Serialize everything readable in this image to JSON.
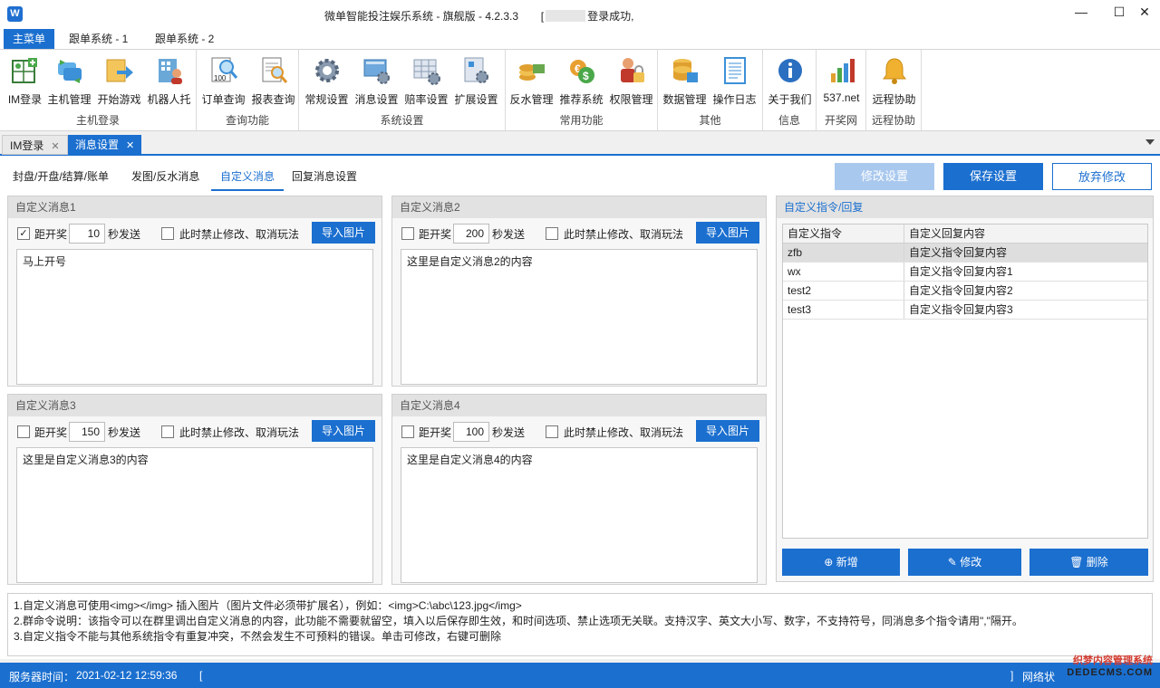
{
  "window": {
    "title_prefix": "微单智能投注娱乐系统 - 旗舰版 - 4.2.3.3",
    "title_bracket_open": "[",
    "title_suffix": "登录成功,",
    "minimize": "—",
    "maximize": "☐",
    "close": "✕",
    "app_icon": "W"
  },
  "ribbon_tabs": [
    "主菜单",
    "跟单系统 - 1",
    "跟单系统 - 2"
  ],
  "ribbon_groups": [
    {
      "label": "主机登录",
      "buttons": [
        "IM登录",
        "主机管理",
        "开始游戏",
        "机器人托"
      ]
    },
    {
      "label": "查询功能",
      "buttons": [
        "订单查询",
        "报表查询"
      ]
    },
    {
      "label": "系统设置",
      "buttons": [
        "常规设置",
        "消息设置",
        "赔率设置",
        "扩展设置"
      ]
    },
    {
      "label": "常用功能",
      "buttons": [
        "反水管理",
        "推荐系统",
        "权限管理"
      ]
    },
    {
      "label": "其他",
      "buttons": [
        "数据管理",
        "操作日志"
      ]
    },
    {
      "label": "信息",
      "buttons": [
        "关于我们"
      ]
    },
    {
      "label": "开奖网",
      "buttons": [
        "537.net"
      ]
    },
    {
      "label": "远程协助",
      "buttons": [
        "远程协助"
      ]
    }
  ],
  "icon_texts": {
    "order_query": "100"
  },
  "doc_tabs": [
    {
      "label": "IM登录",
      "close": "✕"
    },
    {
      "label": "消息设置",
      "close": "✕"
    }
  ],
  "sub_tabs": [
    "封盘/开盘/结算/账单",
    "发图/反水消息",
    "自定义消息",
    "回复消息设置"
  ],
  "top_buttons": {
    "edit": "修改设置",
    "save": "保存设置",
    "discard": "放弃修改"
  },
  "messages": [
    {
      "title": "自定义消息1",
      "checked": true,
      "check_mark": "✓",
      "label_before": "距开奖",
      "seconds": "10",
      "label_after": "秒发送",
      "lock_label": "此时禁止修改、取消玩法",
      "import_label": "导入图片",
      "content": "马上开号"
    },
    {
      "title": "自定义消息2",
      "checked": false,
      "check_mark": "",
      "label_before": "距开奖",
      "seconds": "200",
      "label_after": "秒发送",
      "lock_label": "此时禁止修改、取消玩法",
      "import_label": "导入图片",
      "content": "这里是自定义消息2的内容"
    },
    {
      "title": "自定义消息3",
      "checked": false,
      "check_mark": "",
      "label_before": "距开奖",
      "seconds": "150",
      "label_after": "秒发送",
      "lock_label": "此时禁止修改、取消玩法",
      "import_label": "导入图片",
      "content": "这里是自定义消息3的内容"
    },
    {
      "title": "自定义消息4",
      "checked": false,
      "check_mark": "",
      "label_before": "距开奖",
      "seconds": "100",
      "label_after": "秒发送",
      "lock_label": "此时禁止修改、取消玩法",
      "import_label": "导入图片",
      "content": "这里是自定义消息4的内容"
    }
  ],
  "reply_panel": {
    "title": "自定义指令/回复",
    "columns": [
      "自定义指令",
      "自定义回复内容"
    ],
    "rows": [
      {
        "cmd": "zfb",
        "reply": "自定义指令回复内容"
      },
      {
        "cmd": "wx",
        "reply": "自定义指令回复内容1"
      },
      {
        "cmd": "test2",
        "reply": "自定义指令回复内容2"
      },
      {
        "cmd": "test3",
        "reply": "自定义指令回复内容3"
      }
    ],
    "buttons": {
      "add": "新增",
      "edit": "修改",
      "delete": "删除"
    }
  },
  "notes": [
    "1.自定义消息可使用<img></img> 插入图片（图片文件必须带扩展名），例如：<img>C:\\abc\\123.jpg</img>",
    "2.群命令说明：该指令可以在群里调出自定义消息的内容，此功能不需要就留空，填入以后保存即生效，和时间选项、禁止选项无关联。支持汉字、英文大小写、数字，不支持符号，同消息多个指令请用\",\"隔开。",
    "3.自定义指令不能与其他系统指令有重复冲突，不然会发生不可预料的错误。单击可修改，右键可删除"
  ],
  "status": {
    "server_time_label": "服务器时间：",
    "server_time": "2021-02-12 12:59:36",
    "bracket_open": "[",
    "bracket_close": "]",
    "network_label": "网络状"
  },
  "watermark": {
    "line1": "织梦内容管理系统",
    "line2": "DEDECMS.COM"
  },
  "colors": {
    "accent": "#1b6fcf",
    "disabled": "#a9c8ee",
    "status_bar": "#1b6fcf"
  }
}
